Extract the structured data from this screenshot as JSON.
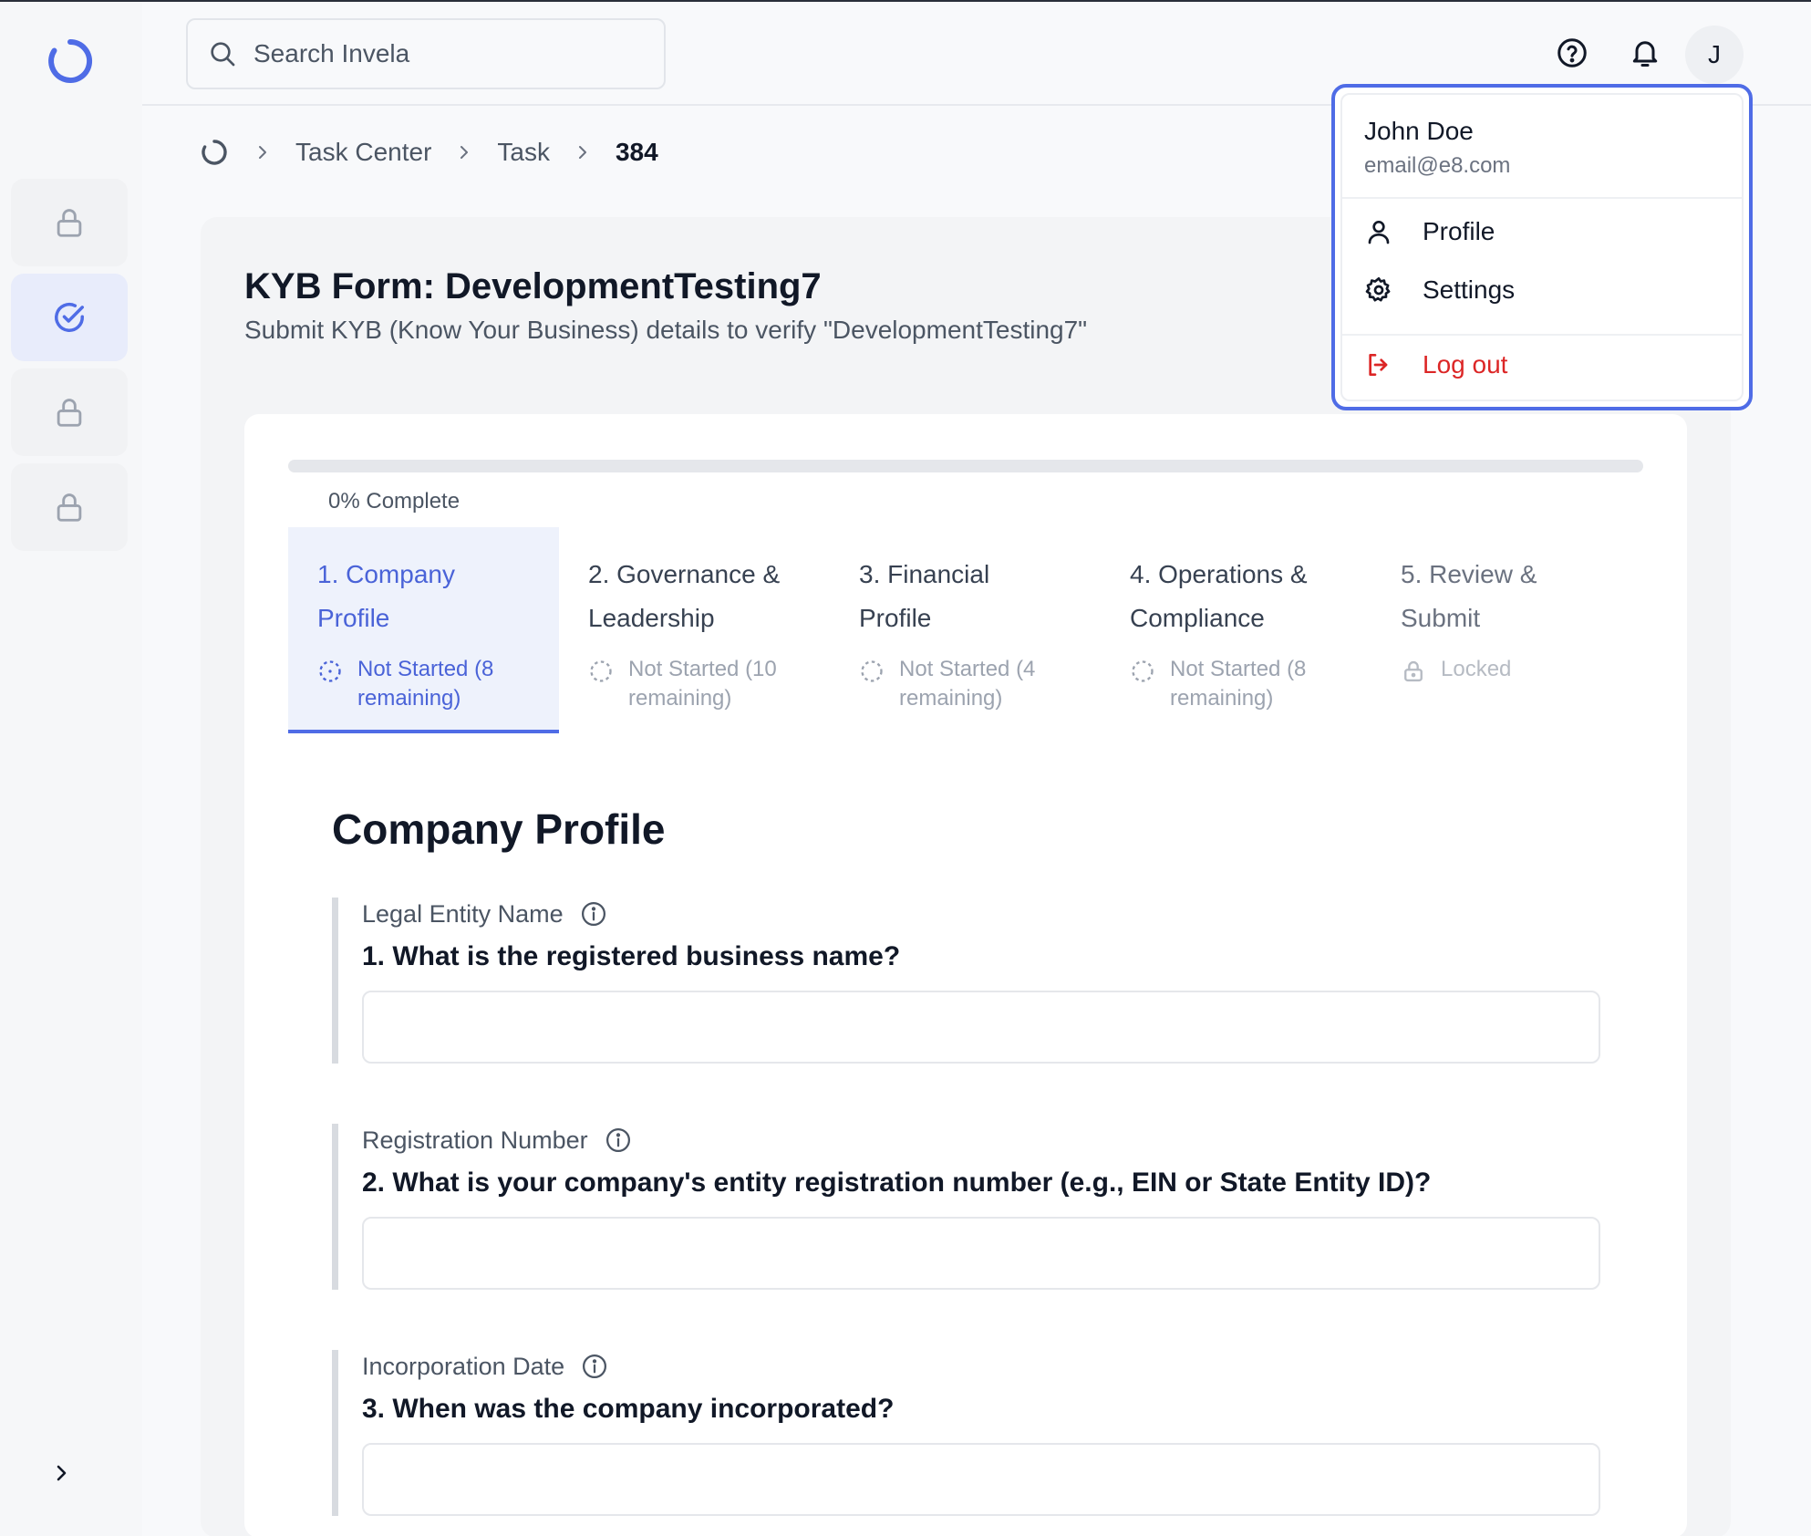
{
  "search": {
    "placeholder": "Search Invela"
  },
  "header": {
    "avatar_initial": "J"
  },
  "breadcrumb": {
    "items": [
      "Task Center",
      "Task"
    ],
    "current": "384"
  },
  "form": {
    "title": "KYB Form: DevelopmentTesting7",
    "subtitle": "Submit KYB (Know Your Business) details to verify \"DevelopmentTesting7\""
  },
  "progress": {
    "percent": 0,
    "label": "0% Complete"
  },
  "steps": [
    {
      "title_line1": "1. Company",
      "title_line2": "Profile",
      "status_line1": "Not Started (8",
      "status_line2": "remaining)"
    },
    {
      "title_line1": "2. Governance &",
      "title_line2": "Leadership",
      "status_line1": "Not Started (10",
      "status_line2": "remaining)"
    },
    {
      "title_line1": "3. Financial",
      "title_line2": "Profile",
      "status_line1": "Not Started (4",
      "status_line2": "remaining)"
    },
    {
      "title_line1": "4. Operations &",
      "title_line2": "Compliance",
      "status_line1": "Not Started (8",
      "status_line2": "remaining)"
    },
    {
      "title_line1": "5. Review &",
      "title_line2": "Submit",
      "status_line1": "Locked",
      "status_line2": ""
    }
  ],
  "section": {
    "title": "Company Profile"
  },
  "fields": [
    {
      "label": "Legal Entity Name",
      "question": "1. What is the registered business name?",
      "value": ""
    },
    {
      "label": "Registration Number",
      "question": "2. What is your company's entity registration number (e.g., EIN or State Entity ID)?",
      "value": ""
    },
    {
      "label": "Incorporation Date",
      "question": "3. When was the company incorporated?",
      "value": ""
    }
  ],
  "user_menu": {
    "name": "John Doe",
    "email": "email@e8.com",
    "profile_label": "Profile",
    "settings_label": "Settings",
    "logout_label": "Log out"
  },
  "colors": {
    "accent": "#4f6ce6",
    "danger": "#dc2626"
  }
}
